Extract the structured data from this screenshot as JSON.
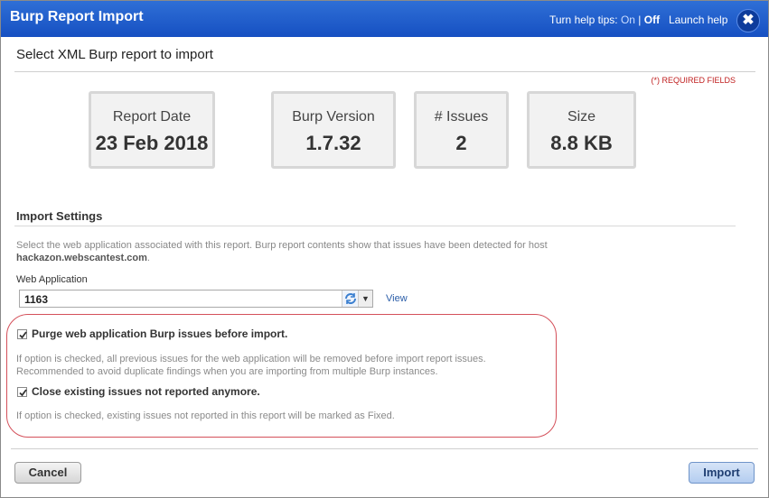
{
  "header": {
    "title": "Burp Report Import",
    "help_tips_label": "Turn help tips:",
    "help_on": "On",
    "help_separator": "|",
    "help_off": "Off",
    "launch_help": "Launch help",
    "close_icon": "close-icon",
    "bar_color": "#1a56c8"
  },
  "subtitle": "Select XML Burp report to import",
  "required_note": "(*) REQUIRED FIELDS",
  "summary": {
    "report_date": {
      "label": "Report Date",
      "value": "23 Feb 2018"
    },
    "burp_version": {
      "label": "Burp Version",
      "value": "1.7.32"
    },
    "issues": {
      "label": "# Issues",
      "value": "2"
    },
    "size": {
      "label": "Size",
      "value": "8.8 KB"
    }
  },
  "settings": {
    "title": "Import Settings",
    "description": "Select the web application associated with this report. Burp report contents show that issues have been detected for host",
    "host": "hackazon.webscantest.com",
    "host_suffix": ".",
    "web_app_label": "Web Application",
    "web_app_value": "1163",
    "view_link": "View",
    "purge": {
      "label": "Purge web application Burp issues before import.",
      "checked": true,
      "hint_line1": "If option is checked, all previous issues for the web application will be removed before import report issues.",
      "hint_line2": "Recommended to avoid duplicate findings when you are importing from multiple Burp instances."
    },
    "close_existing": {
      "label": "Close existing issues not reported anymore.",
      "checked": true,
      "hint": "If option is checked, existing issues not reported in this report will be marked as Fixed."
    }
  },
  "footer": {
    "cancel_label": "Cancel",
    "import_label": "Import"
  }
}
